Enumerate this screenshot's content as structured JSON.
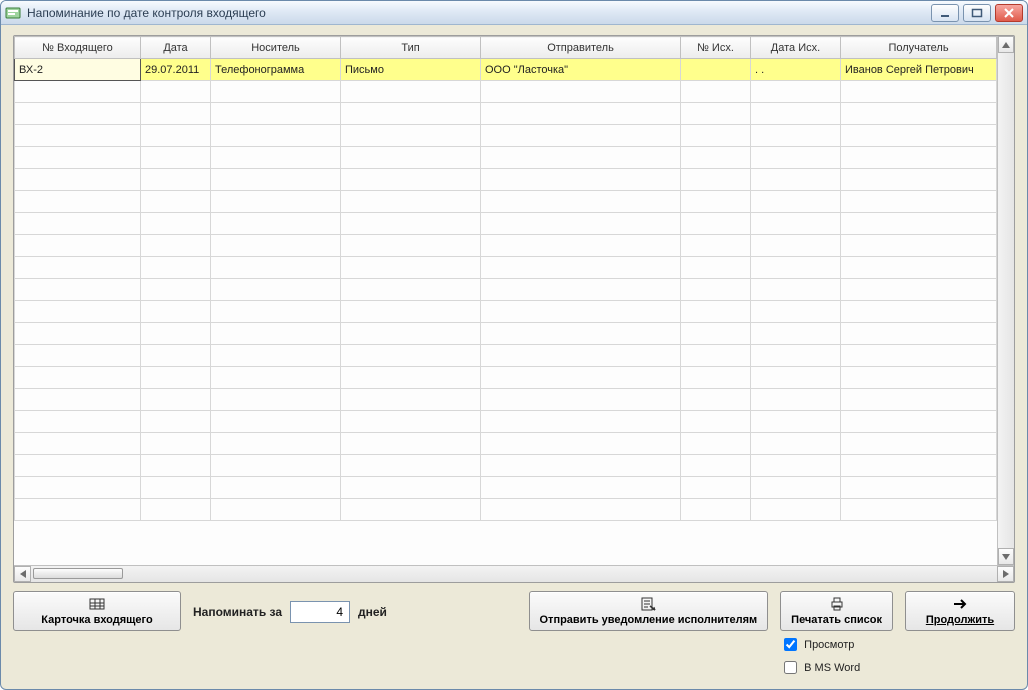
{
  "window": {
    "title": "Напоминание по дате контроля входящего"
  },
  "table": {
    "columns": [
      "№ Входящего",
      "Дата",
      "Носитель",
      "Тип",
      "Отправитель",
      "№ Исх.",
      "Дата Исх.",
      "Получатель"
    ],
    "rows": [
      {
        "num": "ВХ-2",
        "date": "29.07.2011",
        "carrier": "Телефонограмма",
        "type": "Письмо",
        "sender": "ООО \"Ласточка\"",
        "out_no": "",
        "out_date": ".  .",
        "recipient": "Иванов Сергей Петрович"
      }
    ]
  },
  "footer": {
    "card_btn": "Карточка входящего",
    "remind_label": "Напоминать за",
    "remind_value": "4",
    "remind_unit": "дней",
    "notify_btn": "Отправить уведомление исполнителям",
    "print_btn": "Печатать список",
    "continue_btn": "Продолжить",
    "preview_label": "Просмотр",
    "msword_label": "В MS Word",
    "preview_checked": true,
    "msword_checked": false
  }
}
